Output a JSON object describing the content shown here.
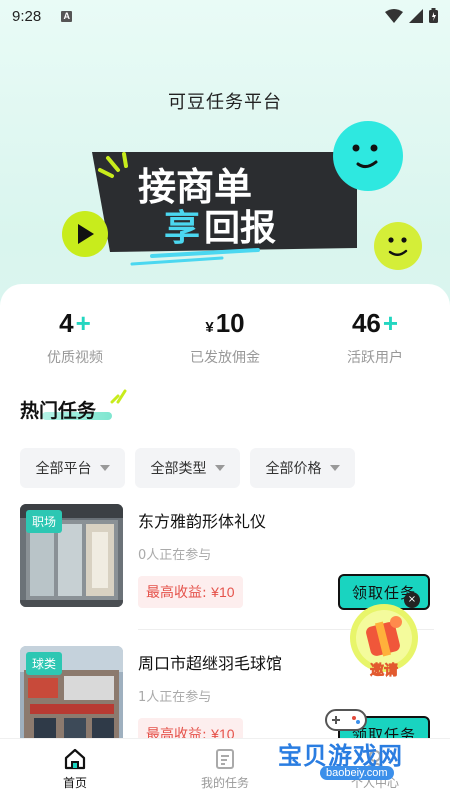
{
  "status_bar": {
    "time": "9:28",
    "notif_letter": "A"
  },
  "header": {
    "title": "可豆任务平台"
  },
  "banner": {
    "line1": "接商单",
    "line2_a": "享",
    "line2_b": "回报"
  },
  "stats": [
    {
      "prefix": "",
      "value": "4",
      "suffix": "+",
      "label": "优质视频"
    },
    {
      "prefix": "¥",
      "value": "10",
      "suffix": "",
      "label": "已发放佣金"
    },
    {
      "prefix": "",
      "value": "46",
      "suffix": "+",
      "label": "活跃用户"
    }
  ],
  "section": {
    "title": "热门任务"
  },
  "filters": [
    {
      "label": "全部平台"
    },
    {
      "label": "全部类型"
    },
    {
      "label": "全部价格"
    }
  ],
  "tasks": [
    {
      "tag": "职场",
      "name": "东方雅韵形体礼仪",
      "participants": "0人正在参与",
      "earn_label": "最高收益:",
      "earn_amount": "¥10",
      "button": "领取任务"
    },
    {
      "tag": "球类",
      "name": "周口市超继羽毛球馆",
      "participants": "1人正在参与",
      "earn_label": "最高收益:",
      "earn_amount": "¥10",
      "button": "领取任务"
    }
  ],
  "invite": {
    "label": "邀请",
    "close": "×"
  },
  "bottom_nav": [
    {
      "label": "首页"
    },
    {
      "label": "我的任务"
    },
    {
      "label": "个人中心"
    }
  ],
  "watermark": {
    "text": "宝贝游戏网",
    "url": "baobeiy.com"
  },
  "colors": {
    "accent": "#19d4c0",
    "earn": "#e5534b",
    "banner_bg": "#2b2d30",
    "smiley": "#2ee8e0",
    "lime": "#c8ec1c"
  }
}
